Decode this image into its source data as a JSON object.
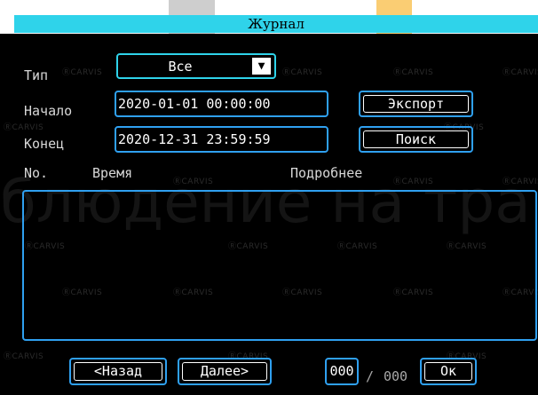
{
  "window": {
    "title": "Журнал"
  },
  "filters": {
    "type_label": "Тип",
    "type_value": "Все",
    "start_label": "Начало",
    "start_value": "2020-01-01 00:00:00",
    "end_label": "Конец",
    "end_value": "2020-12-31 23:59:59"
  },
  "actions": {
    "export_label": "Экспорт",
    "search_label": "Поиск"
  },
  "table": {
    "columns": [
      "No.",
      "Время",
      "Подробнее"
    ],
    "rows": []
  },
  "pager": {
    "prev_label": "<Назад",
    "next_label": "Далее>",
    "current": "000",
    "separator": "/",
    "total": "000",
    "ok_label": "Ок"
  },
  "watermark": {
    "brand": "CARVIS",
    "background_text": "блюдение на тра"
  },
  "colors": {
    "accent": "#2fa0f0",
    "title_bar": "#2fd3ea",
    "background": "#000000",
    "text": "#ffffff"
  },
  "icons": {
    "dropdown": "triangle-down-icon",
    "brand_logo": "carvis-logo-icon"
  }
}
